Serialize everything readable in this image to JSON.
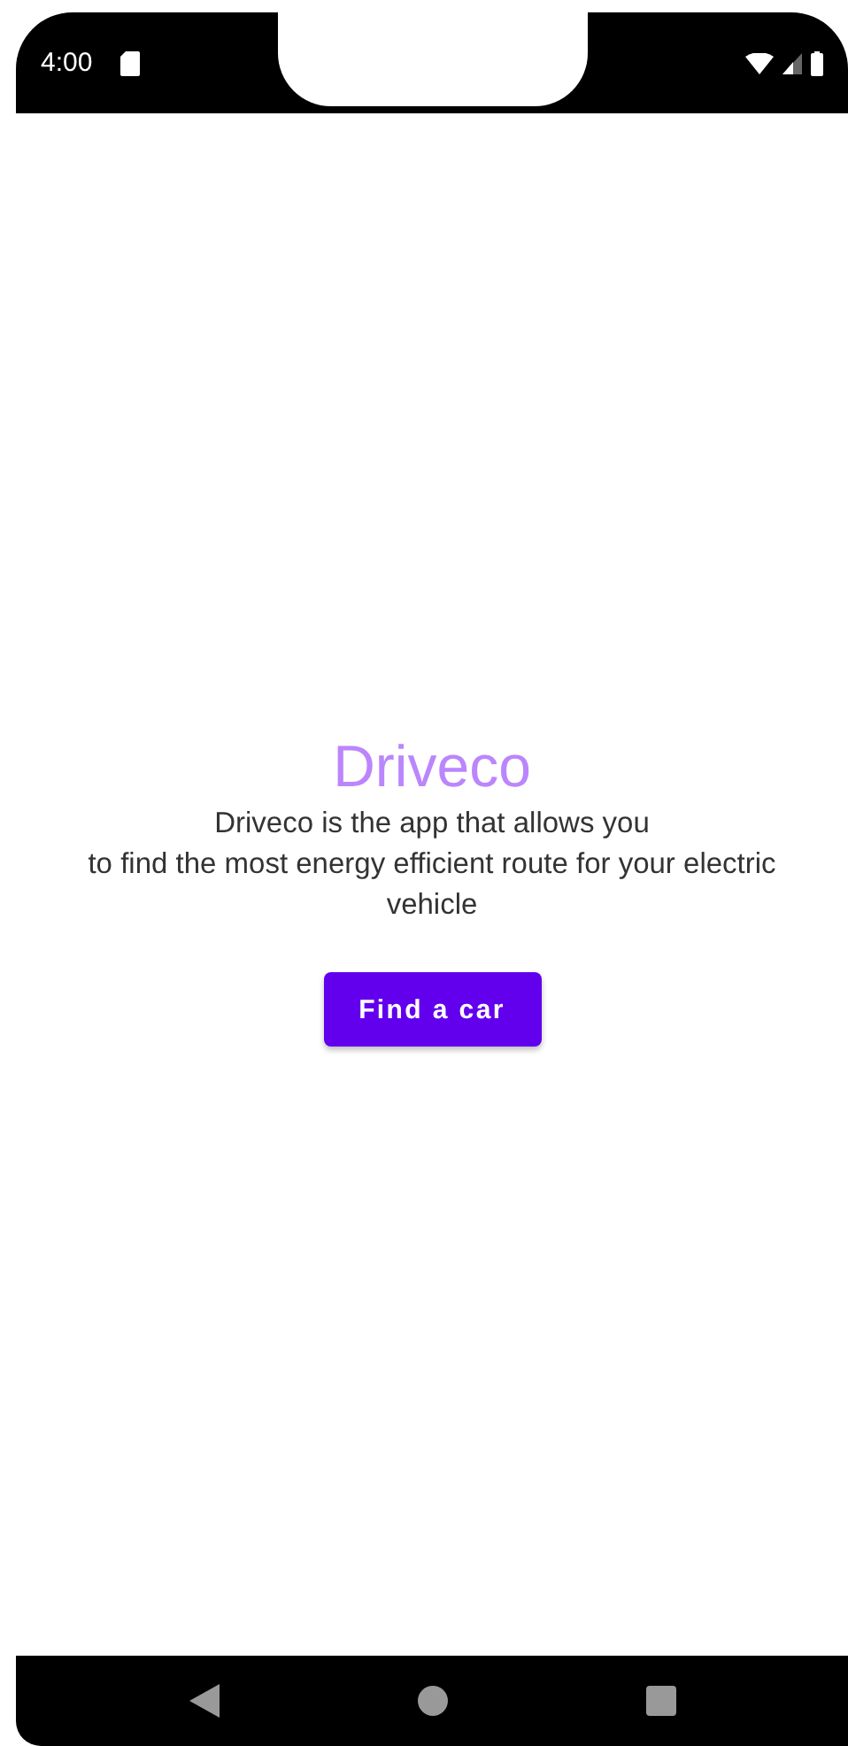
{
  "status_bar": {
    "time": "4:00"
  },
  "app": {
    "title": "Driveco",
    "description": "Driveco is the app that allows you\nto find the most energy efficient route for your electric vehicle",
    "button": "Find a car"
  }
}
